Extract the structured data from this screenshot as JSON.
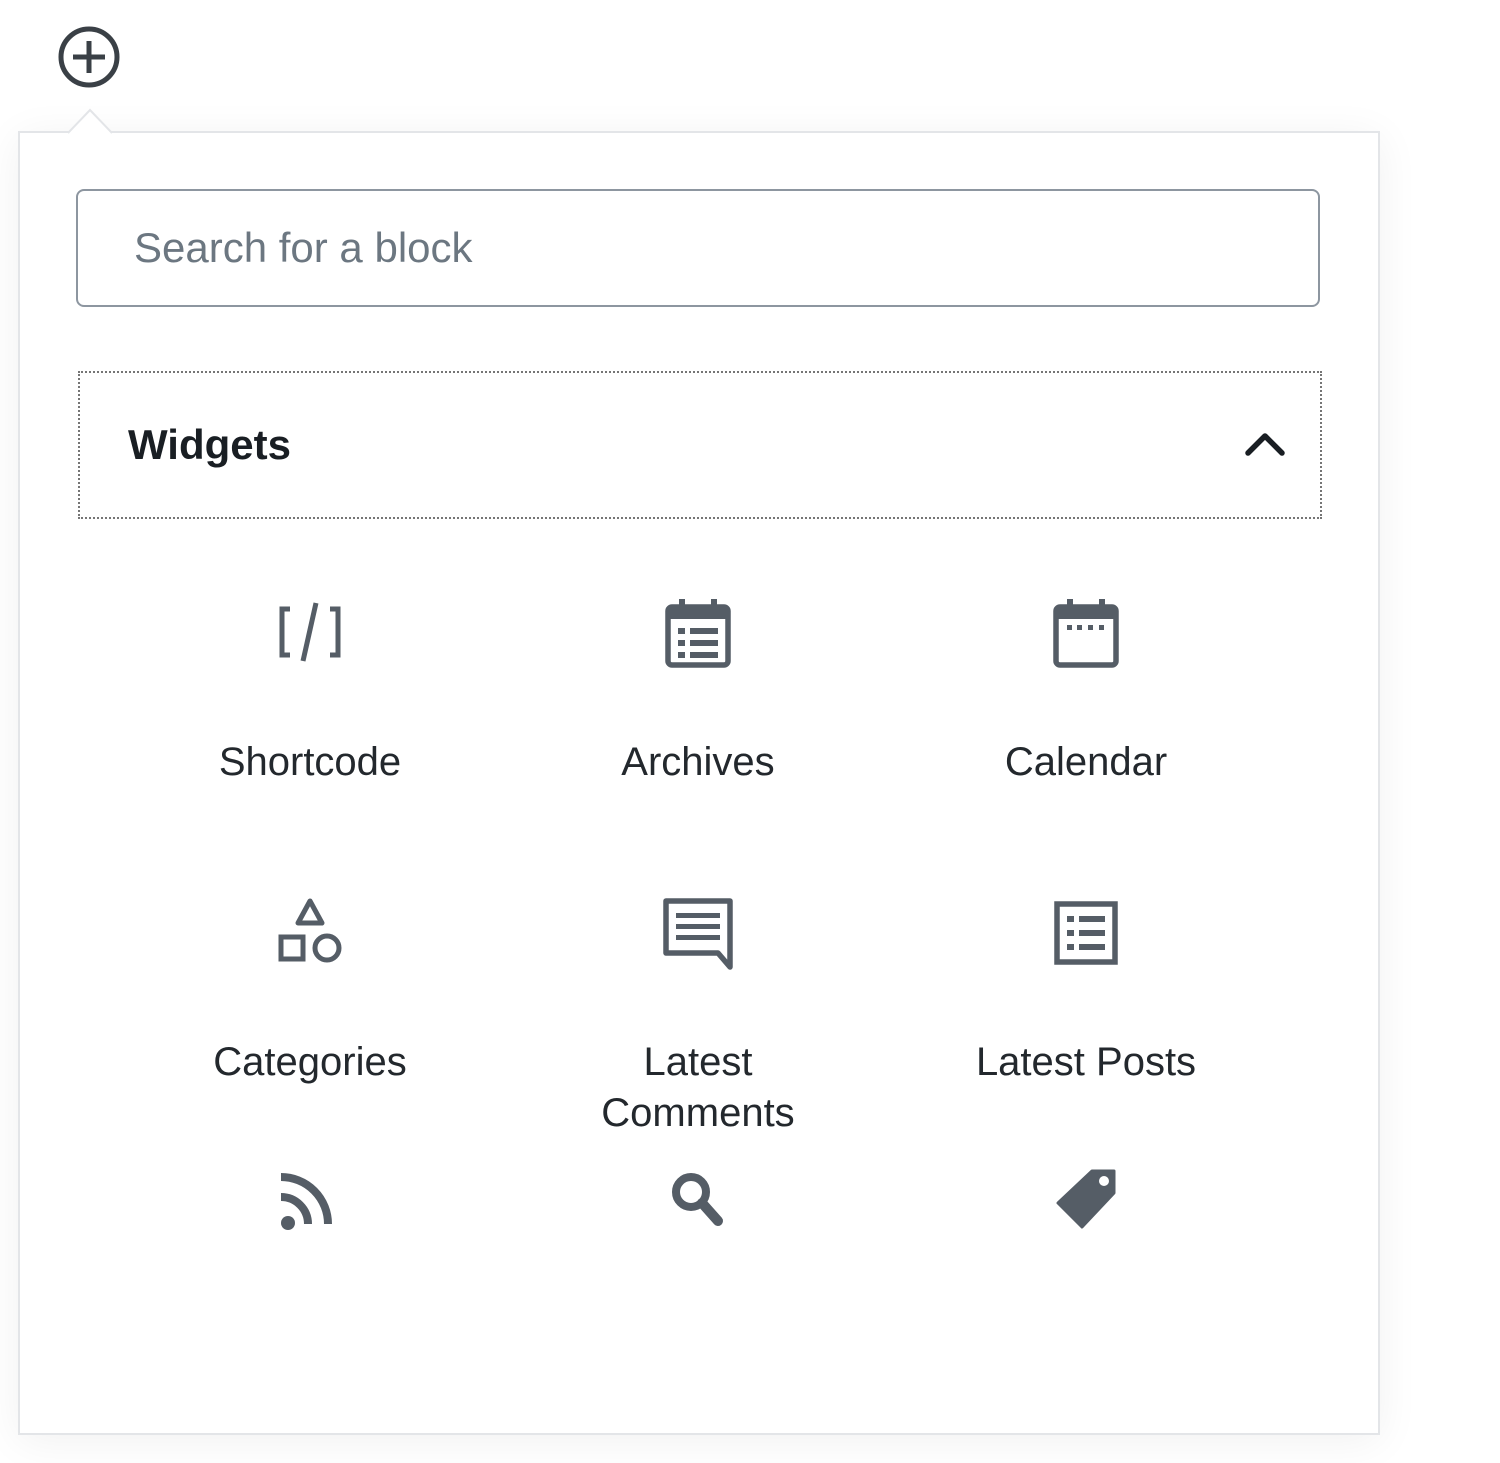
{
  "inserter": {
    "toggle_icon": "plus-circle-icon"
  },
  "search": {
    "placeholder": "Search for a block",
    "value": ""
  },
  "panel": {
    "title": "Widgets",
    "expanded": true,
    "toggle_icon": "chevron-up-icon"
  },
  "blocks": [
    {
      "label": "Shortcode",
      "icon": "shortcode-icon"
    },
    {
      "label": "Archives",
      "icon": "archives-icon"
    },
    {
      "label": "Calendar",
      "icon": "calendar-icon"
    },
    {
      "label": "Categories",
      "icon": "categories-icon"
    },
    {
      "label": "Latest Comments",
      "icon": "latest-comments-icon"
    },
    {
      "label": "Latest Posts",
      "icon": "latest-posts-icon"
    },
    {
      "label": "",
      "icon": "rss-icon"
    },
    {
      "label": "",
      "icon": "search-icon"
    },
    {
      "label": "",
      "icon": "tag-icon"
    }
  ],
  "colors": {
    "icon": "#555d66",
    "text": "#23282d",
    "border": "#8d96a0",
    "placeholder": "#6c7781"
  }
}
